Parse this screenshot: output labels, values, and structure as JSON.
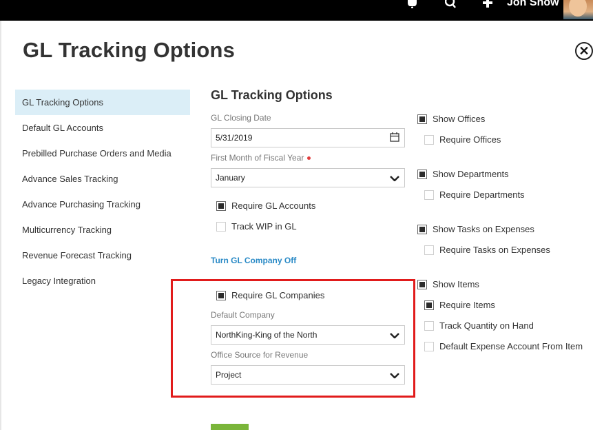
{
  "topbar": {
    "user_name": "Jon Snow",
    "icons": [
      "bell-icon",
      "search-icon",
      "plus-icon"
    ]
  },
  "page": {
    "title": "GL Tracking Options"
  },
  "sidebar": {
    "items": [
      {
        "label": "GL Tracking Options",
        "active": true
      },
      {
        "label": "Default GL Accounts"
      },
      {
        "label": "Prebilled Purchase Orders and Media"
      },
      {
        "label": "Advance Sales Tracking"
      },
      {
        "label": "Advance Purchasing Tracking"
      },
      {
        "label": "Multicurrency Tracking"
      },
      {
        "label": "Revenue Forecast Tracking"
      },
      {
        "label": "Legacy Integration"
      }
    ]
  },
  "form": {
    "section_title": "GL Tracking Options",
    "closing_date": {
      "label": "GL Closing Date",
      "value": "5/31/2019"
    },
    "fiscal_month": {
      "label": "First Month of Fiscal Year",
      "value": "January",
      "required": true
    },
    "require_gl_accounts": {
      "label": "Require GL Accounts",
      "checked": true
    },
    "track_wip": {
      "label": "Track WIP in GL",
      "checked": false
    },
    "turn_off_link": "Turn GL Company Off",
    "require_gl_companies": {
      "label": "Require GL Companies",
      "checked": true
    },
    "default_company": {
      "label": "Default Company",
      "value": "NorthKing-King of the North"
    },
    "office_source": {
      "label": "Office Source for Revenue",
      "value": "Project"
    }
  },
  "options": {
    "show_offices": {
      "label": "Show Offices",
      "checked": true
    },
    "require_offices": {
      "label": "Require Offices",
      "checked": false
    },
    "show_departments": {
      "label": "Show Departments",
      "checked": true
    },
    "require_departments": {
      "label": "Require Departments",
      "checked": false
    },
    "show_tasks": {
      "label": "Show Tasks on Expenses",
      "checked": true
    },
    "require_tasks": {
      "label": "Require Tasks on Expenses",
      "checked": false
    },
    "show_items": {
      "label": "Show Items",
      "checked": true
    },
    "require_items": {
      "label": "Require Items",
      "checked": true
    },
    "track_quantity": {
      "label": "Track Quantity on Hand",
      "checked": false
    },
    "default_expense_account": {
      "label": "Default Expense Account From Item",
      "checked": false
    }
  },
  "colors": {
    "active_bg": "#dbeef7",
    "link": "#2a8ac6",
    "highlight": "#e11b1b",
    "save_button": "#7ab53a"
  }
}
